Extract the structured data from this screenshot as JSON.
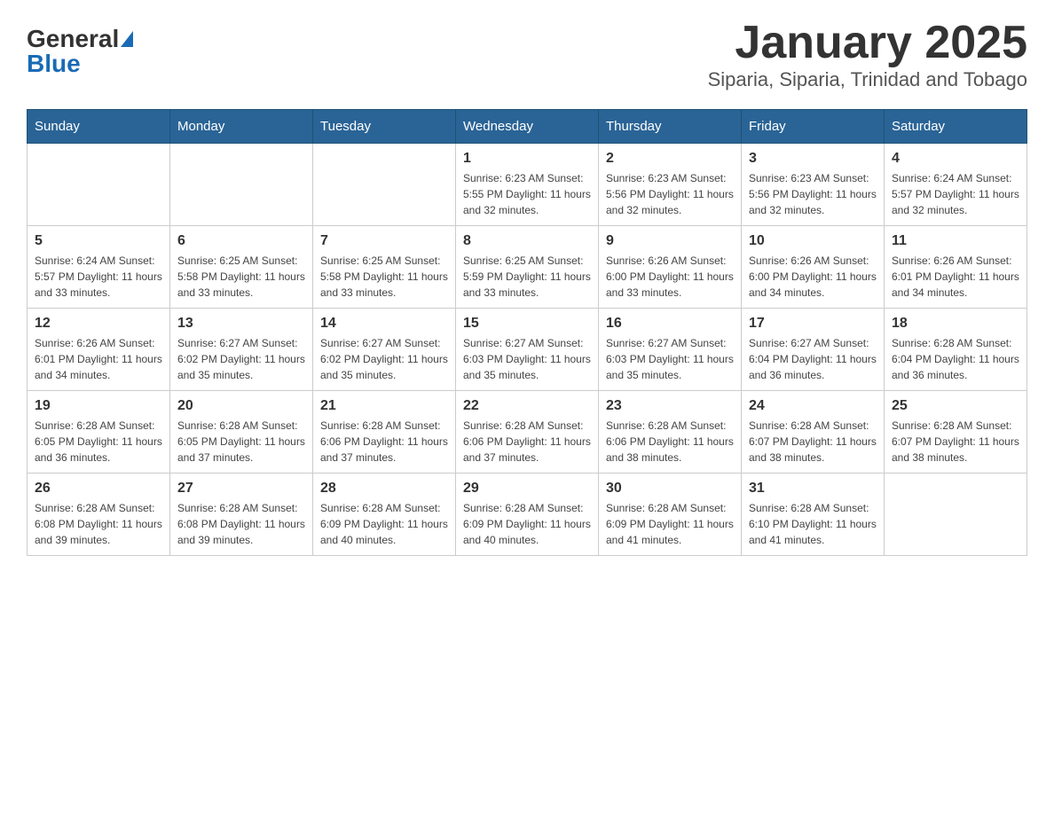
{
  "header": {
    "logo_general": "General",
    "logo_blue": "Blue",
    "title": "January 2025",
    "subtitle": "Siparia, Siparia, Trinidad and Tobago"
  },
  "calendar": {
    "days_of_week": [
      "Sunday",
      "Monday",
      "Tuesday",
      "Wednesday",
      "Thursday",
      "Friday",
      "Saturday"
    ],
    "weeks": [
      [
        {
          "day": "",
          "info": ""
        },
        {
          "day": "",
          "info": ""
        },
        {
          "day": "",
          "info": ""
        },
        {
          "day": "1",
          "info": "Sunrise: 6:23 AM\nSunset: 5:55 PM\nDaylight: 11 hours and 32 minutes."
        },
        {
          "day": "2",
          "info": "Sunrise: 6:23 AM\nSunset: 5:56 PM\nDaylight: 11 hours and 32 minutes."
        },
        {
          "day": "3",
          "info": "Sunrise: 6:23 AM\nSunset: 5:56 PM\nDaylight: 11 hours and 32 minutes."
        },
        {
          "day": "4",
          "info": "Sunrise: 6:24 AM\nSunset: 5:57 PM\nDaylight: 11 hours and 32 minutes."
        }
      ],
      [
        {
          "day": "5",
          "info": "Sunrise: 6:24 AM\nSunset: 5:57 PM\nDaylight: 11 hours and 33 minutes."
        },
        {
          "day": "6",
          "info": "Sunrise: 6:25 AM\nSunset: 5:58 PM\nDaylight: 11 hours and 33 minutes."
        },
        {
          "day": "7",
          "info": "Sunrise: 6:25 AM\nSunset: 5:58 PM\nDaylight: 11 hours and 33 minutes."
        },
        {
          "day": "8",
          "info": "Sunrise: 6:25 AM\nSunset: 5:59 PM\nDaylight: 11 hours and 33 minutes."
        },
        {
          "day": "9",
          "info": "Sunrise: 6:26 AM\nSunset: 6:00 PM\nDaylight: 11 hours and 33 minutes."
        },
        {
          "day": "10",
          "info": "Sunrise: 6:26 AM\nSunset: 6:00 PM\nDaylight: 11 hours and 34 minutes."
        },
        {
          "day": "11",
          "info": "Sunrise: 6:26 AM\nSunset: 6:01 PM\nDaylight: 11 hours and 34 minutes."
        }
      ],
      [
        {
          "day": "12",
          "info": "Sunrise: 6:26 AM\nSunset: 6:01 PM\nDaylight: 11 hours and 34 minutes."
        },
        {
          "day": "13",
          "info": "Sunrise: 6:27 AM\nSunset: 6:02 PM\nDaylight: 11 hours and 35 minutes."
        },
        {
          "day": "14",
          "info": "Sunrise: 6:27 AM\nSunset: 6:02 PM\nDaylight: 11 hours and 35 minutes."
        },
        {
          "day": "15",
          "info": "Sunrise: 6:27 AM\nSunset: 6:03 PM\nDaylight: 11 hours and 35 minutes."
        },
        {
          "day": "16",
          "info": "Sunrise: 6:27 AM\nSunset: 6:03 PM\nDaylight: 11 hours and 35 minutes."
        },
        {
          "day": "17",
          "info": "Sunrise: 6:27 AM\nSunset: 6:04 PM\nDaylight: 11 hours and 36 minutes."
        },
        {
          "day": "18",
          "info": "Sunrise: 6:28 AM\nSunset: 6:04 PM\nDaylight: 11 hours and 36 minutes."
        }
      ],
      [
        {
          "day": "19",
          "info": "Sunrise: 6:28 AM\nSunset: 6:05 PM\nDaylight: 11 hours and 36 minutes."
        },
        {
          "day": "20",
          "info": "Sunrise: 6:28 AM\nSunset: 6:05 PM\nDaylight: 11 hours and 37 minutes."
        },
        {
          "day": "21",
          "info": "Sunrise: 6:28 AM\nSunset: 6:06 PM\nDaylight: 11 hours and 37 minutes."
        },
        {
          "day": "22",
          "info": "Sunrise: 6:28 AM\nSunset: 6:06 PM\nDaylight: 11 hours and 37 minutes."
        },
        {
          "day": "23",
          "info": "Sunrise: 6:28 AM\nSunset: 6:06 PM\nDaylight: 11 hours and 38 minutes."
        },
        {
          "day": "24",
          "info": "Sunrise: 6:28 AM\nSunset: 6:07 PM\nDaylight: 11 hours and 38 minutes."
        },
        {
          "day": "25",
          "info": "Sunrise: 6:28 AM\nSunset: 6:07 PM\nDaylight: 11 hours and 38 minutes."
        }
      ],
      [
        {
          "day": "26",
          "info": "Sunrise: 6:28 AM\nSunset: 6:08 PM\nDaylight: 11 hours and 39 minutes."
        },
        {
          "day": "27",
          "info": "Sunrise: 6:28 AM\nSunset: 6:08 PM\nDaylight: 11 hours and 39 minutes."
        },
        {
          "day": "28",
          "info": "Sunrise: 6:28 AM\nSunset: 6:09 PM\nDaylight: 11 hours and 40 minutes."
        },
        {
          "day": "29",
          "info": "Sunrise: 6:28 AM\nSunset: 6:09 PM\nDaylight: 11 hours and 40 minutes."
        },
        {
          "day": "30",
          "info": "Sunrise: 6:28 AM\nSunset: 6:09 PM\nDaylight: 11 hours and 41 minutes."
        },
        {
          "day": "31",
          "info": "Sunrise: 6:28 AM\nSunset: 6:10 PM\nDaylight: 11 hours and 41 minutes."
        },
        {
          "day": "",
          "info": ""
        }
      ]
    ]
  }
}
